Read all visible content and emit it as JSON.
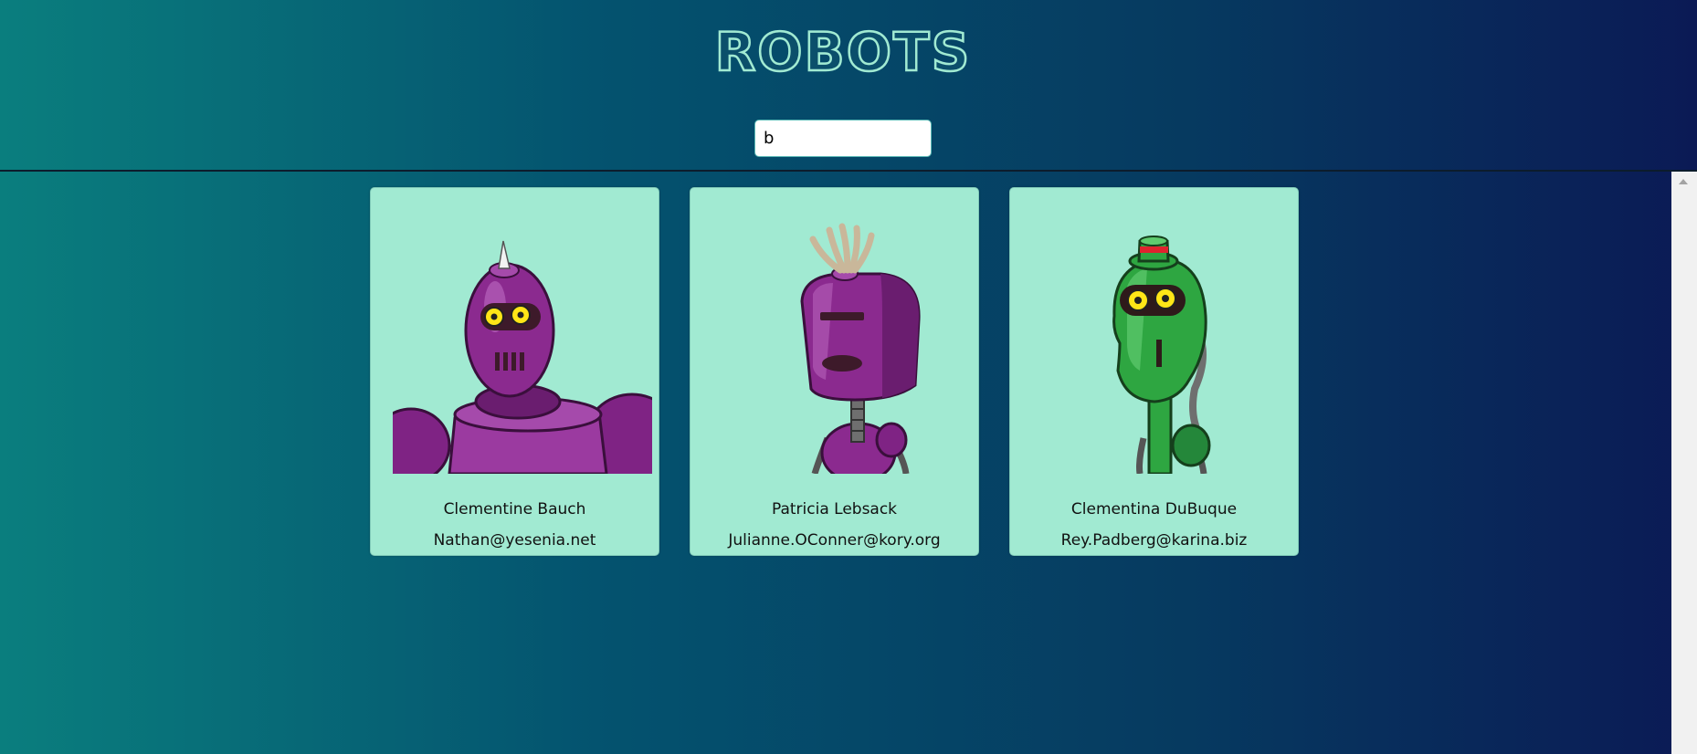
{
  "app": {
    "title": "ROBOTS"
  },
  "search": {
    "value": "b"
  },
  "robots": [
    {
      "name": "Clementine Bauch",
      "email": "Nathan@yesenia.net",
      "color": "#8b2a8f",
      "image": "purple-spike-robot"
    },
    {
      "name": "Patricia Lebsack",
      "email": "Julianne.OConner@kory.org",
      "color": "#8b2a8f",
      "image": "purple-mop-robot"
    },
    {
      "name": "Clementina DuBuque",
      "email": "Rey.Padberg@karina.biz",
      "color": "#2ea641",
      "image": "green-hat-robot"
    }
  ],
  "colors": {
    "card": "#a1ead2",
    "title_outline": "#a1ead2"
  }
}
